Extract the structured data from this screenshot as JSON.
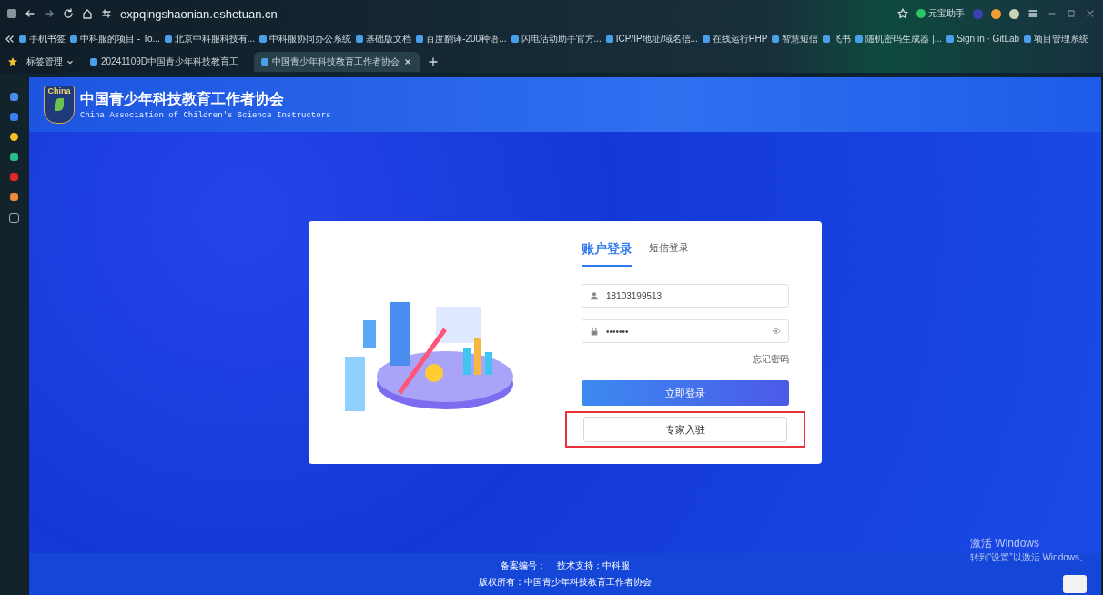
{
  "browser": {
    "url": "expqingshaonian.eshetuan.cn",
    "extension_label": "元宝助手",
    "bookmarks": [
      "手机书签",
      "中科服的项目 - To...",
      "北京中科服科技有...",
      "中科服协同办公系统",
      "基础版文档",
      "百度翻译-200种语...",
      "闪电活动助手官方...",
      "ICP/IP地址/域名信...",
      "在线运行PHP",
      "智慧短信",
      "飞书",
      "随机密码生成器 |...",
      "Sign in · GitLab",
      "项目管理系统"
    ],
    "tab_group": "标签管理",
    "tabs": [
      {
        "title": "20241109D中国青少年科技教育工",
        "selected": false
      },
      {
        "title": "中国青少年科技教育工作者协会",
        "selected": true
      }
    ]
  },
  "header": {
    "title": "中国青少年科技教育工作者协会",
    "subtitle": "China Association of Children's Science Instructors",
    "logo_text": "China"
  },
  "login": {
    "tabs": [
      {
        "label": "账户登录",
        "selected": true
      },
      {
        "label": "短信登录",
        "selected": false
      }
    ],
    "username": {
      "value": "18103199513"
    },
    "password": {
      "value": "•••••••"
    },
    "forgot": "忘记密码",
    "submit": "立即登录",
    "expert": {
      "label": "专家入驻",
      "highlighted": true
    }
  },
  "footer": {
    "line1": [
      "备案编号：",
      "技术支持：中科服"
    ],
    "line2": "版权所有：中国青少年科技教育工作者协会"
  },
  "os_notice": {
    "title": "激活 Windows",
    "body": "转到“设置”以激活 Windows。"
  }
}
